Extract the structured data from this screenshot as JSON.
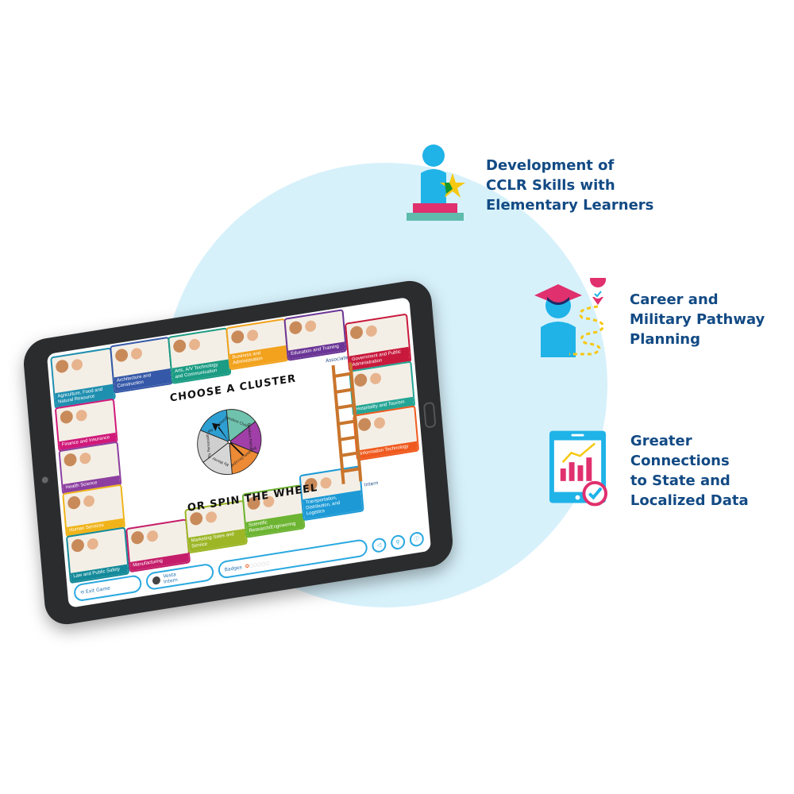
{
  "features": [
    {
      "icon": "student-podium-star-icon",
      "lines": [
        "Development of",
        "CCLR Skills with",
        "Elementary Learners"
      ]
    },
    {
      "icon": "graduate-pathway-map-pin-icon",
      "lines": [
        "Career and",
        "Military Pathway",
        "Planning"
      ]
    },
    {
      "icon": "tablet-chart-check-icon",
      "lines": [
        "Greater Connections",
        "to State and",
        "Localized Data"
      ]
    }
  ],
  "game": {
    "heading_top": "CHOOSE A CLUSTER",
    "heading_bottom": "OR SPIN THE WHEEL",
    "ladder": {
      "top_label": "Associate",
      "bottom_label": "Intern"
    },
    "wheel_segments": [
      {
        "label": "My Interests",
        "color": "#2e9fd2"
      },
      {
        "label": "Random Cluster",
        "color": "#6fc2ad"
      },
      {
        "label": "Random Pathway",
        "color": "#a03fa8"
      },
      {
        "label": "Random Occupation",
        "color": "#ec8a35"
      },
      {
        "label": "My Money",
        "color": "#d6d6d6"
      },
      {
        "label": "My Personality",
        "color": "#cfcfcf"
      }
    ],
    "clusters": [
      {
        "label": "Agriculture, Food and Natural Resource",
        "color": "#1f8fb0"
      },
      {
        "label": "Architecture and Construction",
        "color": "#3558a8"
      },
      {
        "label": "Arts, A/V Technology and Communication",
        "color": "#1b9c84"
      },
      {
        "label": "Business and Administration",
        "color": "#f2a21c"
      },
      {
        "label": "Education and Training",
        "color": "#6a3596"
      },
      {
        "label": "Finance and Insurance",
        "color": "#d0197a"
      },
      {
        "label": "Government and Public Administration",
        "color": "#c8193c"
      },
      {
        "label": "Health Science",
        "color": "#8c3fa0"
      },
      {
        "label": "Hospitality and Tourism",
        "color": "#24a595"
      },
      {
        "label": "Human Services",
        "color": "#f0b41a"
      },
      {
        "label": "Information Technology",
        "color": "#f05a1e"
      },
      {
        "label": "Law and Public Safety",
        "color": "#148a9a"
      },
      {
        "label": "Manufacturing",
        "color": "#c41d6a"
      },
      {
        "label": "Marketing Sales and Service",
        "color": "#9cb626"
      },
      {
        "label": "Scientific Research/Engineering",
        "color": "#6cb431"
      },
      {
        "label": "Transportation, Distribution, and Logistics",
        "color": "#1d9ad6"
      }
    ],
    "bottom_bar": {
      "exit_label": "Exit Game",
      "player_name": "Vesta",
      "player_level": "Intern",
      "badges_label": "Badges"
    }
  }
}
